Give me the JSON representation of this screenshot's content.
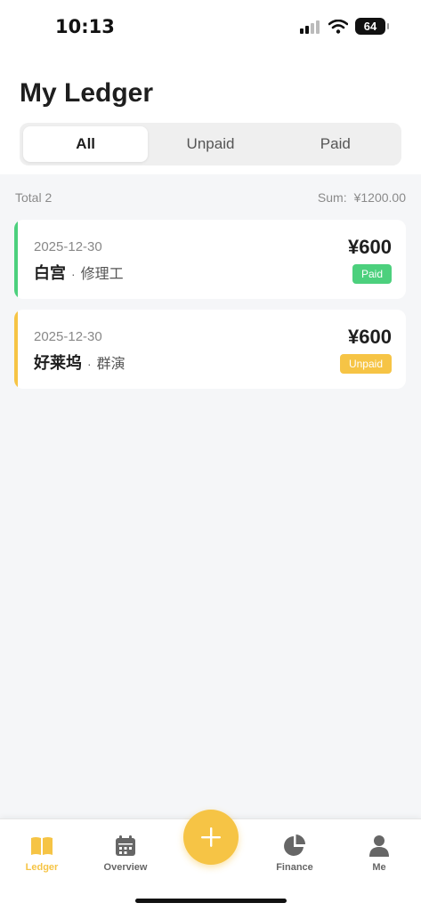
{
  "status_bar": {
    "time": "10:13",
    "battery": "64"
  },
  "header": {
    "title": "My Ledger",
    "filters": [
      {
        "label": "All",
        "active": true
      },
      {
        "label": "Unpaid",
        "active": false
      },
      {
        "label": "Paid",
        "active": false
      }
    ]
  },
  "summary": {
    "total": "Total 2",
    "sum_label": "Sum:",
    "sum_value": "¥1200.00"
  },
  "records": [
    {
      "date": "2025-12-30",
      "name": "白宫",
      "role": "修理工",
      "amount": "¥600",
      "status": "Paid",
      "color": "#4cd07d"
    },
    {
      "date": "2025-12-30",
      "name": "好莱坞",
      "role": "群演",
      "amount": "¥600",
      "status": "Unpaid",
      "color": "#f6c445"
    }
  ],
  "tabbar": {
    "items": [
      {
        "label": "Ledger",
        "icon": "book-icon",
        "active": true
      },
      {
        "label": "Overview",
        "icon": "calendar-icon",
        "active": false
      },
      {
        "label": "Finance",
        "icon": "pie-chart-icon",
        "active": false
      },
      {
        "label": "Me",
        "icon": "person-icon",
        "active": false
      }
    ],
    "add_icon": "plus-icon"
  },
  "colors": {
    "accent": "#f6c445",
    "paid": "#4cd07d",
    "background": "#f5f6f8"
  }
}
